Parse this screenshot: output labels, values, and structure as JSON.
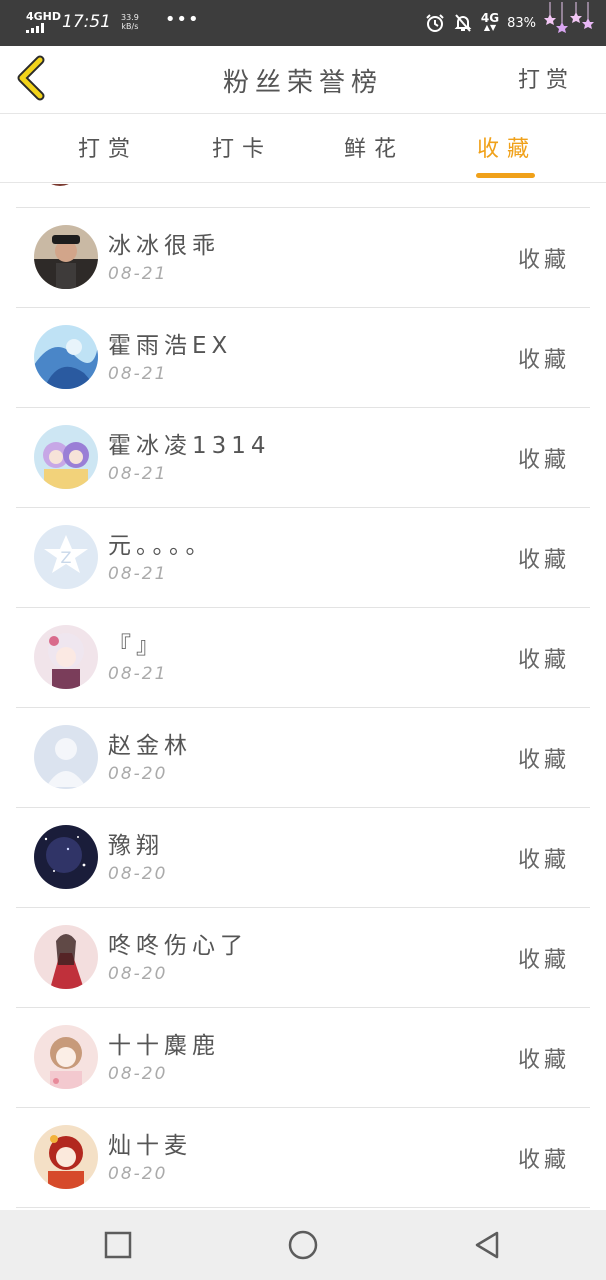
{
  "status_bar": {
    "network": "4GHD",
    "time": "17:51",
    "speed_value": "33.9",
    "speed_unit": "kB/s",
    "dots": "•••",
    "net_right": "4G",
    "battery": "83%"
  },
  "header": {
    "title": "粉丝荣誉榜",
    "right_action": "打赏"
  },
  "tabs": [
    {
      "label": "打赏",
      "active": false
    },
    {
      "label": "打卡",
      "active": false
    },
    {
      "label": "鲜花",
      "active": false
    },
    {
      "label": "收藏",
      "active": true
    }
  ],
  "accent_color": "#f0a11a",
  "rows": [
    {
      "name": "冰冰很乖",
      "date": "08-21",
      "action": "收藏"
    },
    {
      "name": "霍雨浩EX",
      "date": "08-21",
      "action": "收藏"
    },
    {
      "name": "霍冰凌1314",
      "date": "08-21",
      "action": "收藏"
    },
    {
      "name": "元。。。。",
      "date": "08-21",
      "action": "收藏"
    },
    {
      "name": "『』",
      "date": "08-21",
      "action": "收藏"
    },
    {
      "name": "赵金林",
      "date": "08-20",
      "action": "收藏"
    },
    {
      "name": "豫翔",
      "date": "08-20",
      "action": "收藏"
    },
    {
      "name": "咚咚伤心了",
      "date": "08-20",
      "action": "收藏"
    },
    {
      "name": "十十麋鹿",
      "date": "08-20",
      "action": "收藏"
    },
    {
      "name": "灿十麦",
      "date": "08-20",
      "action": "收藏"
    }
  ]
}
